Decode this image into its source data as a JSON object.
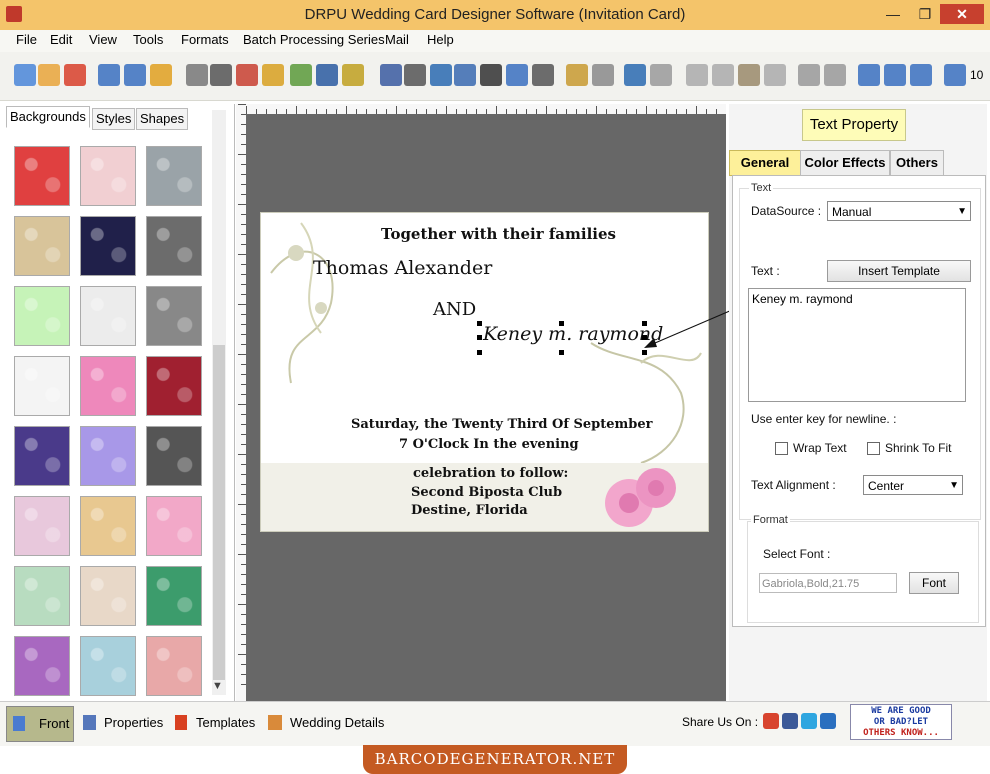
{
  "window": {
    "title": "DRPU Wedding Card Designer Software (Invitation Card)",
    "minimize": "—",
    "restore": "❐",
    "close": "✕"
  },
  "menu": [
    "File",
    "Edit",
    "View",
    "Tools",
    "Formats",
    "Batch Processing Series",
    "Mail",
    "Help"
  ],
  "toolbar": {
    "zoom_value": "10",
    "icons": [
      "new-icon",
      "open-icon",
      "close-doc-icon",
      "save-icon",
      "save-as-icon",
      "export-icon",
      "properties-icon",
      "print-icon",
      "print-batch-icon",
      "gift-icon",
      "add-image-icon",
      "pen-icon",
      "picture-icon",
      "barcode-icon",
      "barcode2-icon",
      "text-icon",
      "word-art-icon",
      "signature-icon",
      "mail-icon",
      "line-icon",
      "database-icon",
      "database2-icon",
      "undo-icon",
      "redo-icon",
      "copy-icon",
      "copy2-icon",
      "paste-icon",
      "paste2-icon",
      "bring-front-icon",
      "send-back-icon",
      "grid-icon",
      "actual-size-icon",
      "fit-icon",
      "zoom-in-icon"
    ]
  },
  "left_panel": {
    "tabs": [
      "Backgrounds",
      "Styles",
      "Shapes"
    ],
    "active_tab": "Backgrounds",
    "thumbnail_colors": [
      [
        "#e04040",
        "#f1cfd2",
        "#9aa3a8"
      ],
      [
        "#d8c49a",
        "#20204a",
        "#6c6c6c"
      ],
      [
        "#c6f3b8",
        "#ececec",
        "#888888"
      ],
      [
        "#f4f4f4",
        "#ee88bb",
        "#a02030"
      ],
      [
        "#4a3a8a",
        "#a898e8",
        "#555555"
      ],
      [
        "#e8c8dc",
        "#e8c890",
        "#f2a8c8"
      ],
      [
        "#b8dcc0",
        "#e8d8c8",
        "#3c9c6c"
      ],
      [
        "#a868c0",
        "#a8d0dc",
        "#e8a8a8"
      ]
    ]
  },
  "card": {
    "line1": "Together with their families",
    "groom": "Thomas Alexander",
    "and": "AND",
    "bride": "Keney m. raymond",
    "date": "Saturday, the Twenty Third Of September",
    "time": "7 O'Clock In the evening",
    "reception": "celebration to follow:",
    "venue": "Second Biposta Club",
    "city": "Destine, Florida"
  },
  "text_property": {
    "title": "Text Property",
    "tabs": [
      "General",
      "Color Effects",
      "Others"
    ],
    "text_group_label": "Text",
    "datasource_label": "DataSource :",
    "datasource_value": "Manual",
    "text_label": "Text :",
    "insert_template_button": "Insert Template",
    "text_value": "Keney m. raymond",
    "enter_hint": "Use enter key for newline. :",
    "wrap_text_label": "Wrap Text",
    "shrink_fit_label": "Shrink To Fit",
    "alignment_label": "Text Alignment :",
    "alignment_value": "Center",
    "format_group_label": "Format",
    "select_font_label": "Select Font :",
    "font_value": "Gabriola,Bold,21.75",
    "font_button": "Font"
  },
  "bottom_tabs": [
    "Front",
    "Properties",
    "Templates",
    "Wedding Details"
  ],
  "share_label": "Share Us On :",
  "feedback_line1": "WE ARE GOOD",
  "feedback_line2": "OR BAD?LET",
  "feedback_line3": "OTHERS KNOW...",
  "footer_banner": "BARCODEGENERATOR.NET"
}
